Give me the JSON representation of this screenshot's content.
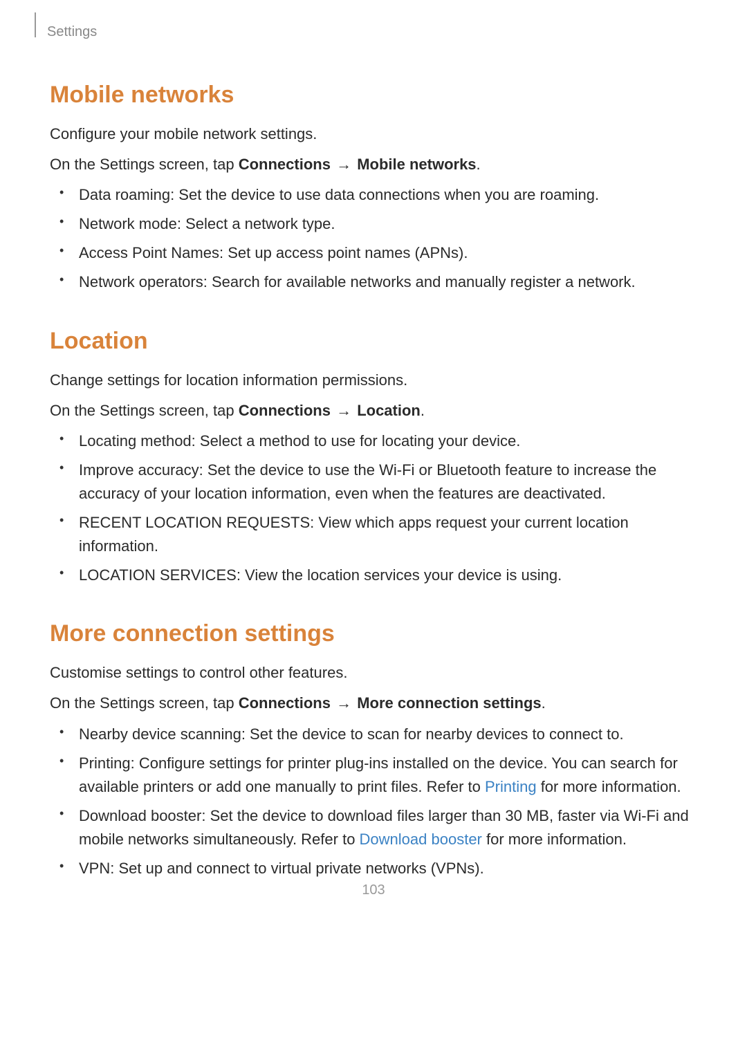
{
  "header": {
    "label": "Settings"
  },
  "sections": {
    "mobile": {
      "heading": "Mobile networks",
      "intro": "Configure your mobile network settings.",
      "path_prefix": "On the Settings screen, tap ",
      "path_bold1": "Connections",
      "arrow": " → ",
      "path_bold2": "Mobile networks",
      "path_suffix": ".",
      "items": {
        "i0": {
          "name": "Data roaming",
          "desc": ": Set the device to use data connections when you are roaming."
        },
        "i1": {
          "name": "Network mode",
          "desc": ": Select a network type."
        },
        "i2": {
          "name": "Access Point Names",
          "desc": ": Set up access point names (APNs)."
        },
        "i3": {
          "name": "Network operators",
          "desc": ": Search for available networks and manually register a network."
        }
      }
    },
    "location": {
      "heading": "Location",
      "intro": "Change settings for location information permissions.",
      "path_prefix": "On the Settings screen, tap ",
      "path_bold1": "Connections",
      "arrow": " → ",
      "path_bold2": "Location",
      "path_suffix": ".",
      "items": {
        "i0": {
          "name": "Locating method",
          "desc": ": Select a method to use for locating your device."
        },
        "i1": {
          "name": "Improve accuracy",
          "desc": ": Set the device to use the Wi-Fi or Bluetooth feature to increase the accuracy of your location information, even when the features are deactivated."
        },
        "i2": {
          "name": "RECENT LOCATION REQUESTS",
          "desc": ": View which apps request your current location information."
        },
        "i3": {
          "name": "LOCATION SERVICES",
          "desc": ": View the location services your device is using."
        }
      }
    },
    "more": {
      "heading": "More connection settings",
      "intro": "Customise settings to control other features.",
      "path_prefix": "On the Settings screen, tap ",
      "path_bold1": "Connections",
      "arrow": " → ",
      "path_bold2": "More connection settings",
      "path_suffix": ".",
      "items": {
        "i0": {
          "name": "Nearby device scanning",
          "desc": ": Set the device to scan for nearby devices to connect to."
        },
        "i1": {
          "name": "Printing",
          "desc_a": ": Configure settings for printer plug-ins installed on the device. You can search for available printers or add one manually to print files. Refer to ",
          "link": "Printing",
          "desc_b": " for more information."
        },
        "i2": {
          "name": "Download booster",
          "desc_a": ": Set the device to download files larger than 30 MB, faster via Wi-Fi and mobile networks simultaneously. Refer to ",
          "link": "Download booster",
          "desc_b": " for more information."
        },
        "i3": {
          "name": "VPN",
          "desc": ": Set up and connect to virtual private networks (VPNs)."
        }
      }
    }
  },
  "page_number": "103"
}
